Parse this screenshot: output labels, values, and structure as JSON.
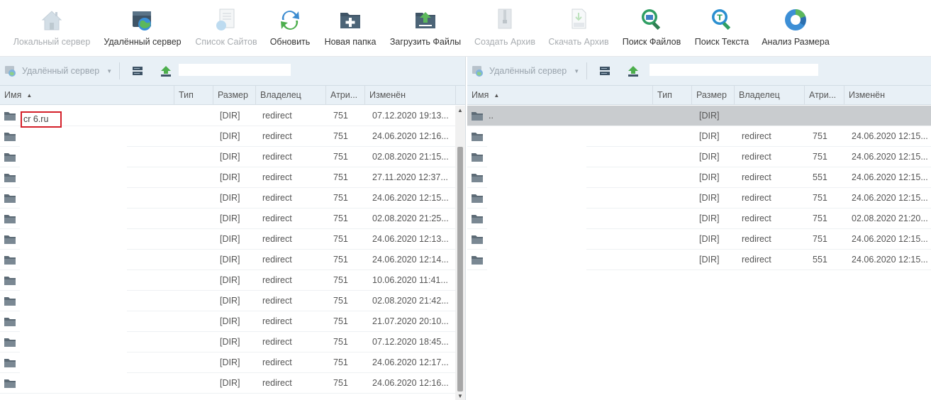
{
  "toolbar": {
    "items": [
      {
        "label": "Локальный сервер",
        "icon": "home-icon",
        "disabled": true
      },
      {
        "label": "Удалённый сервер",
        "icon": "remote-server-icon",
        "disabled": false
      },
      {
        "label": "Список Сайтов",
        "icon": "site-list-icon",
        "disabled": true
      },
      {
        "label": "Обновить",
        "icon": "refresh-icon",
        "disabled": false
      },
      {
        "label": "Новая папка",
        "icon": "new-folder-icon",
        "disabled": false
      },
      {
        "label": "Загрузить Файлы",
        "icon": "upload-files-icon",
        "disabled": false
      },
      {
        "label": "Создать Архив",
        "icon": "create-archive-icon",
        "disabled": true
      },
      {
        "label": "Скачать Архив",
        "icon": "download-archive-icon",
        "disabled": true
      },
      {
        "label": "Поиск Файлов",
        "icon": "search-files-icon",
        "disabled": false
      },
      {
        "label": "Поиск Текста",
        "icon": "search-text-icon",
        "disabled": false
      },
      {
        "label": "Анализ Размера",
        "icon": "size-analysis-icon",
        "disabled": false
      }
    ]
  },
  "columns": {
    "name": "Имя",
    "type": "Тип",
    "size": "Размер",
    "owner": "Владелец",
    "attrs": "Атри...",
    "modified": "Изменён"
  },
  "left": {
    "server_label": "Удалённый сервер",
    "path_value": "",
    "rows": [
      {
        "name": "cr  6.ru",
        "size": "[DIR]",
        "owner": "redirect",
        "attrs": "751",
        "modified": "07.12.2020 19:13..."
      },
      {
        "name": "",
        "size": "[DIR]",
        "owner": "redirect",
        "attrs": "751",
        "modified": "24.06.2020 12:16..."
      },
      {
        "name": "",
        "size": "[DIR]",
        "owner": "redirect",
        "attrs": "751",
        "modified": "02.08.2020 21:15..."
      },
      {
        "name": "",
        "size": "[DIR]",
        "owner": "redirect",
        "attrs": "751",
        "modified": "27.11.2020 12:37..."
      },
      {
        "name": "",
        "size": "[DIR]",
        "owner": "redirect",
        "attrs": "751",
        "modified": "24.06.2020 12:15..."
      },
      {
        "name": "",
        "size": "[DIR]",
        "owner": "redirect",
        "attrs": "751",
        "modified": "02.08.2020 21:25..."
      },
      {
        "name": "",
        "size": "[DIR]",
        "owner": "redirect",
        "attrs": "751",
        "modified": "24.06.2020 12:13..."
      },
      {
        "name": "",
        "size": "[DIR]",
        "owner": "redirect",
        "attrs": "751",
        "modified": "24.06.2020 12:14..."
      },
      {
        "name": "",
        "size": "[DIR]",
        "owner": "redirect",
        "attrs": "751",
        "modified": "10.06.2020 11:41..."
      },
      {
        "name": "",
        "size": "[DIR]",
        "owner": "redirect",
        "attrs": "751",
        "modified": "02.08.2020 21:42..."
      },
      {
        "name": "",
        "size": "[DIR]",
        "owner": "redirect",
        "attrs": "751",
        "modified": "21.07.2020 20:10..."
      },
      {
        "name": "",
        "size": "[DIR]",
        "owner": "redirect",
        "attrs": "751",
        "modified": "07.12.2020 18:45..."
      },
      {
        "name": "",
        "size": "[DIR]",
        "owner": "redirect",
        "attrs": "751",
        "modified": "24.06.2020 12:17..."
      },
      {
        "name": "",
        "size": "[DIR]",
        "owner": "redirect",
        "attrs": "751",
        "modified": "24.06.2020 12:16..."
      }
    ]
  },
  "right": {
    "server_label": "Удалённый сервер",
    "path_value": "",
    "rows": [
      {
        "name": "..",
        "size": "[DIR]",
        "owner": "",
        "attrs": "",
        "modified": "",
        "selected": true
      },
      {
        "name": "",
        "size": "[DIR]",
        "owner": "redirect",
        "attrs": "751",
        "modified": "24.06.2020 12:15..."
      },
      {
        "name": "",
        "size": "[DIR]",
        "owner": "redirect",
        "attrs": "751",
        "modified": "24.06.2020 12:15..."
      },
      {
        "name": "",
        "size": "[DIR]",
        "owner": "redirect",
        "attrs": "551",
        "modified": "24.06.2020 12:15..."
      },
      {
        "name": "",
        "size": "[DIR]",
        "owner": "redirect",
        "attrs": "751",
        "modified": "24.06.2020 12:15..."
      },
      {
        "name": "",
        "size": "[DIR]",
        "owner": "redirect",
        "attrs": "751",
        "modified": "02.08.2020 21:20..."
      },
      {
        "name": "",
        "size": "[DIR]",
        "owner": "redirect",
        "attrs": "751",
        "modified": "24.06.2020 12:15..."
      },
      {
        "name": "",
        "size": "[DIR]",
        "owner": "redirect",
        "attrs": "551",
        "modified": "24.06.2020 12:15..."
      }
    ]
  },
  "colors": {
    "panel_header_bg": "#e8f0f6",
    "selected_row_bg": "#c9cccf",
    "highlight_border": "#d4202a",
    "disabled_text": "#a9adb1"
  }
}
